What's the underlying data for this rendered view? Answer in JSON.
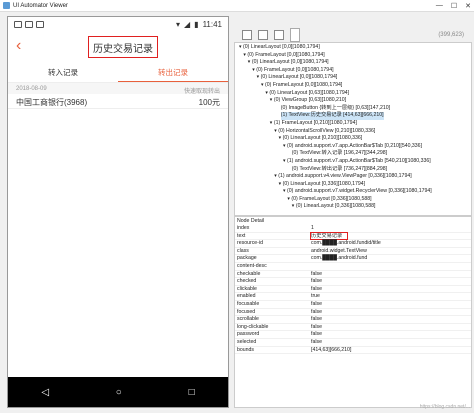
{
  "window": {
    "title": "UI Automator Viewer",
    "controls": [
      "—",
      "☐",
      "✕"
    ]
  },
  "phone": {
    "status": {
      "time": "11:41"
    },
    "appbar": {
      "back_icon": "‹",
      "title": "历史交易记录"
    },
    "tabs": [
      {
        "label": "转入记录",
        "active": false
      },
      {
        "label": "转出记录",
        "active": true
      }
    ],
    "list_header": {
      "date": "2018-08-09",
      "action": "快速取现转出"
    },
    "list_rows": [
      {
        "name": "中国工商银行(3968)",
        "amount": "100元"
      }
    ],
    "navbar": {
      "back": "◁",
      "home": "○",
      "recent": "□"
    }
  },
  "toolbar": {
    "coords": "(399,623)"
  },
  "tree": [
    "▾ (0) LinearLayout [0,0][1080,1794]",
    "  ▾ (0) FrameLayout [0,0][1080,1794]",
    "    ▾ (0) LinearLayout [0,0][1080,1794]",
    "      ▾ (0) FrameLayout [0,0][1080,1794]",
    "        ▾ (0) LinearLayout [0,0][1080,1794]",
    "          ▾ (0) FrameLayout [0,0][1080,1794]",
    "            ▾ (0) LinearLayout [0,63][1080,1794]",
    "              ▾ (0) ViewGroup [0,63][1080,210]",
    "                   (0) ImageButton {转到上一层级} [0,63][147,210]",
    "                   (1) TextView:历史交易记录 [414,63][666,210]",
    "              ▾ (1) FrameLayout [0,210][1080,1794]",
    "                ▾ (0) HorizontalScrollView [0,210][1080,336]",
    "                  ▾ (0) LinearLayout [0,210][1080,336]",
    "                    ▾ (0) android.support.v7.app.ActionBar$Tab [0,210][540,336]",
    "                        (0) TextView:转入记录 [196,247][344,298]",
    "                    ▾ (1) android.support.v7.app.ActionBar$Tab [540,210][1080,336]",
    "                        (0) TextView:转出记录 [736,247][884,298]",
    "                ▾ (1) android.support.v4.view.ViewPager [0,336][1080,1794]",
    "                  ▾ (0) LinearLayout [0,336][1080,1794]",
    "                    ▾ (0) android.support.v7.widget.RecyclerView [0,336][1080,1794]",
    "                      ▾ (0) FrameLayout [0,336][1080,588]",
    "                        ▾ (0) LinearLayout [0,336][1080,588]"
  ],
  "selected_tree_index": 9,
  "detail": {
    "header": "Node Detail",
    "rows": [
      {
        "k": "index",
        "v": "1"
      },
      {
        "k": "text",
        "v": "历史交易记录",
        "highlight": true
      },
      {
        "k": "resource-id",
        "v": "com.████.android.fundid/title"
      },
      {
        "k": "class",
        "v": "android.widget.TextView"
      },
      {
        "k": "package",
        "v": "com.████.android.fund"
      },
      {
        "k": "content-desc",
        "v": ""
      },
      {
        "k": "checkable",
        "v": "false"
      },
      {
        "k": "checked",
        "v": "false"
      },
      {
        "k": "clickable",
        "v": "false"
      },
      {
        "k": "enabled",
        "v": "true"
      },
      {
        "k": "focusable",
        "v": "false"
      },
      {
        "k": "focused",
        "v": "false"
      },
      {
        "k": "scrollable",
        "v": "false"
      },
      {
        "k": "long-clickable",
        "v": "false"
      },
      {
        "k": "password",
        "v": "false"
      },
      {
        "k": "selected",
        "v": "false"
      },
      {
        "k": "bounds",
        "v": "[414,63][666,210]"
      }
    ]
  },
  "watermark": "https://blog.csdn.net/..."
}
